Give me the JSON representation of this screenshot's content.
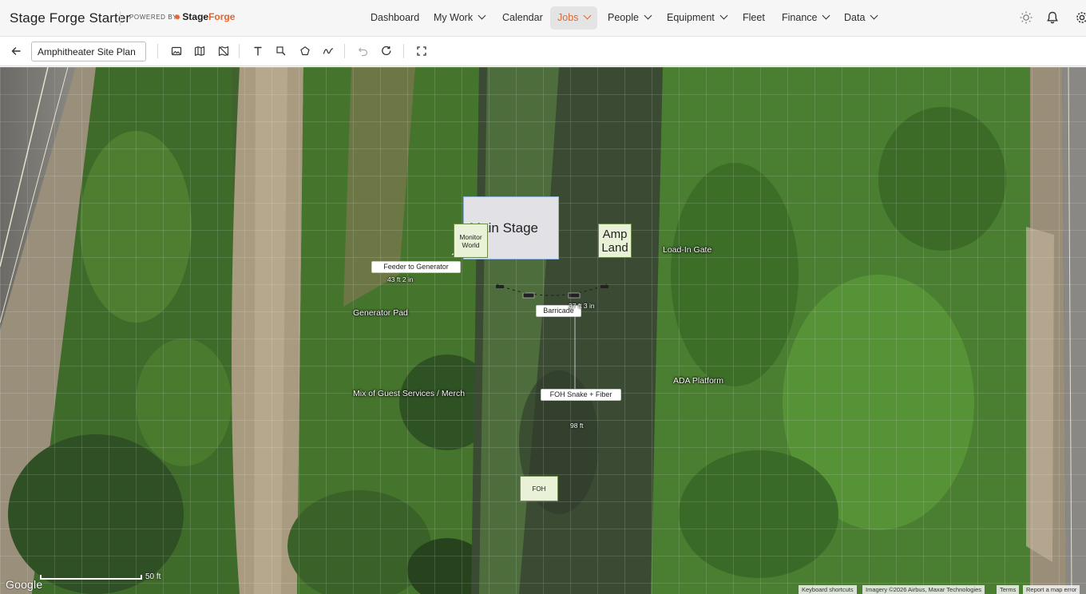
{
  "app": {
    "title": "Stage Forge Starter",
    "powered_by": "POWERED BY",
    "logo_stage": "Stage",
    "logo_forge": "Forge"
  },
  "nav": {
    "items": [
      {
        "label": "Dashboard",
        "dropdown": false,
        "active": false
      },
      {
        "label": "My Work",
        "dropdown": true,
        "active": false
      },
      {
        "label": "Calendar",
        "dropdown": false,
        "active": false
      },
      {
        "label": "Jobs",
        "dropdown": true,
        "active": true
      },
      {
        "label": "People",
        "dropdown": true,
        "active": false
      },
      {
        "label": "Equipment",
        "dropdown": true,
        "active": false
      },
      {
        "label": "Fleet",
        "dropdown": false,
        "active": false
      },
      {
        "label": "Finance",
        "dropdown": true,
        "active": false
      },
      {
        "label": "Data",
        "dropdown": true,
        "active": false
      }
    ],
    "right_icons": [
      "sun-icon",
      "bell-icon",
      "gear-icon"
    ]
  },
  "toolbar": {
    "plan_name": "Amphitheater Site Plan",
    "tools": [
      "back-arrow-icon",
      "image-icon",
      "map-icon",
      "map-off-icon",
      "text-tool-icon",
      "rectangle-tool-icon",
      "polygon-tool-icon",
      "freehand-tool-icon",
      "undo-icon",
      "redo-icon",
      "fullscreen-icon"
    ]
  },
  "map": {
    "zones": {
      "main_stage": "Main Stage",
      "amp_land": "Amp Land",
      "monitor_world": "Monitor World",
      "foh": "FOH"
    },
    "tags": {
      "feeder": "Feeder to Generator",
      "barricade": "Barricade",
      "foh_snake": "FOH Snake + Fiber"
    },
    "labels": {
      "load_in_gate": "Load-In Gate",
      "generator_pad": "Generator Pad",
      "guest_services": "Mix of Guest Services / Merch",
      "ada_platform": "ADA Platform"
    },
    "dimensions": {
      "feeder_length": "43 ft 2 in",
      "barricade_length": "37 ft 3 in",
      "snake_length": "98 ft"
    },
    "google_logo": "Google",
    "scale_label": "50 ft",
    "attribution": {
      "shortcuts": "Keyboard shortcuts",
      "imagery": "Imagery ©2026 Airbus, Maxar Technologies",
      "terms": "Terms",
      "report": "Report a map error"
    }
  },
  "colors": {
    "accent": "#e8632b",
    "zone_fill": "#e9f2d6",
    "stage_fill": "#e2e2e6",
    "stage_border": "#8fb3d9"
  }
}
